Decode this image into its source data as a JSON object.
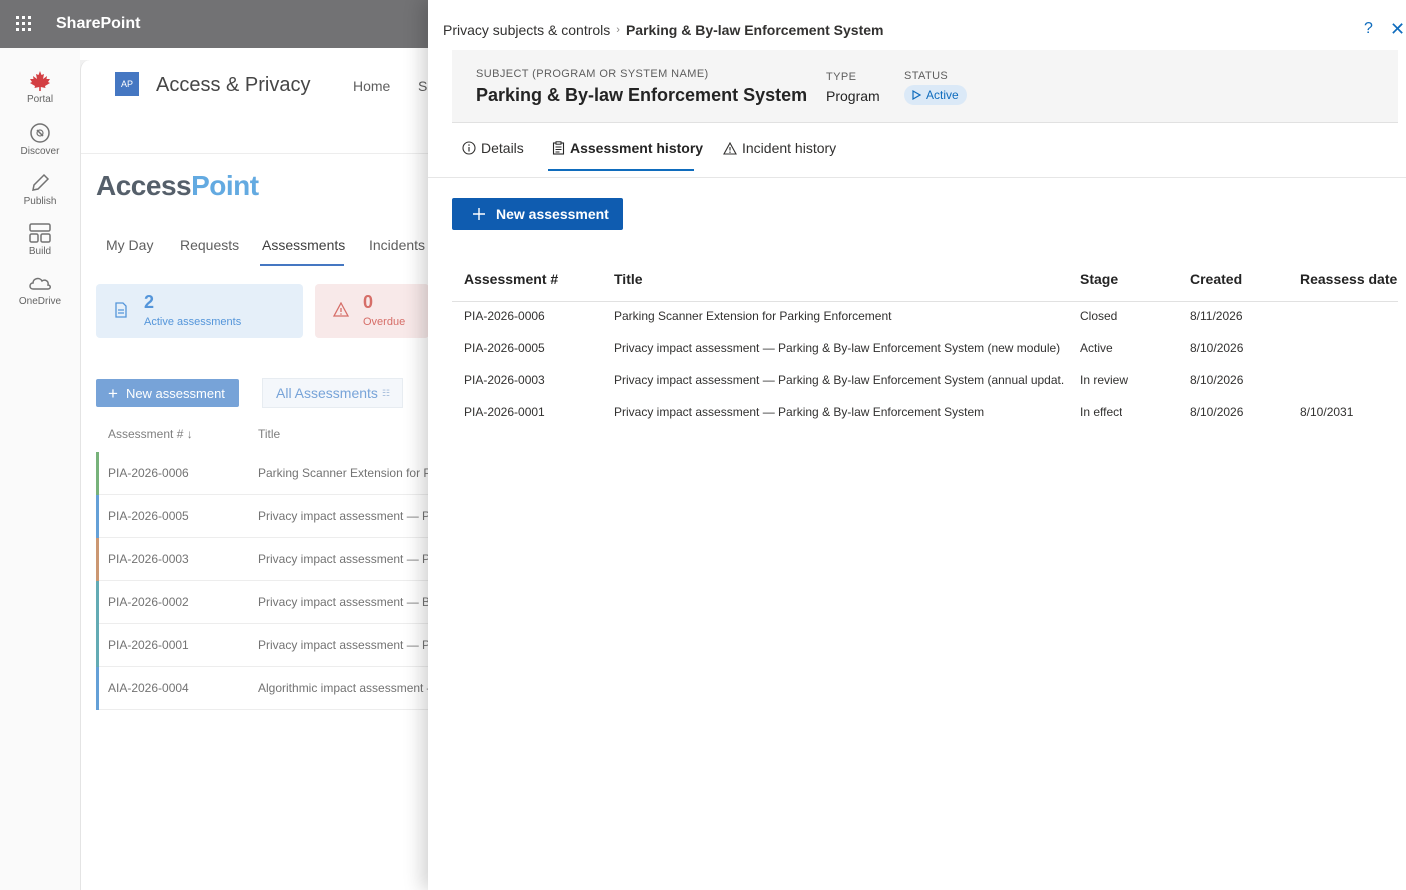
{
  "suite": {
    "app_name": "SharePoint"
  },
  "app_rail": [
    {
      "label": "Portal",
      "icon": "maple-leaf-icon"
    },
    {
      "label": "Discover",
      "icon": "compass-icon"
    },
    {
      "label": "Publish",
      "icon": "pen-icon"
    },
    {
      "label": "Build",
      "icon": "grid-icon"
    },
    {
      "label": "OneDrive",
      "icon": "cloud-icon"
    }
  ],
  "site": {
    "logo_text": "AP",
    "title": "Access & Privacy",
    "nav": [
      "Home",
      "Si"
    ]
  },
  "app": {
    "logo_part1": "Access",
    "logo_part2": "Point",
    "tabs": [
      "My Day",
      "Requests",
      "Assessments",
      "Incidents"
    ],
    "active_tab": "Assessments",
    "cards": [
      {
        "value": "2",
        "label": "Active assessments",
        "color": "#4a8fd8"
      },
      {
        "value": "0",
        "label": "Overdue",
        "color": "#d4655f"
      }
    ],
    "new_button": "New assessment",
    "view_label": "All Assessments",
    "columns": [
      "Assessment #",
      "Title"
    ],
    "rows": [
      {
        "id": "PIA-2026-0006",
        "title": "Parking Scanner Extension for Parking Enforcement",
        "color": "#6fae72"
      },
      {
        "id": "PIA-2026-0005",
        "title": "Privacy impact assessment — Parking & By-law Enforcement System (new module)",
        "color": "#5b9bd5"
      },
      {
        "id": "PIA-2026-0003",
        "title": "Privacy impact assessment — Parking & By-law Enforcement System (annual update)",
        "color": "#c8916a"
      },
      {
        "id": "PIA-2026-0002",
        "title": "Privacy impact assessment — Building permits",
        "color": "#5aa6b0"
      },
      {
        "id": "PIA-2026-0001",
        "title": "Privacy impact assessment — Parking & By-law Enforcement System",
        "color": "#5aa6b0"
      },
      {
        "id": "AIA-2026-0004",
        "title": "Algorithmic impact assessment —",
        "color": "#5b9bd5"
      }
    ]
  },
  "panel": {
    "breadcrumb": [
      "Privacy subjects & controls",
      "Parking & By-law Enforcement System"
    ],
    "header": {
      "subject_label": "SUBJECT (PROGRAM OR SYSTEM NAME)",
      "subject": "Parking & By-law Enforcement System",
      "type_label": "TYPE",
      "type": "Program",
      "status_label": "STATUS",
      "status": "Active"
    },
    "tabs": [
      {
        "label": "Details",
        "icon": "info-icon"
      },
      {
        "label": "Assessment history",
        "icon": "clipboard-icon"
      },
      {
        "label": "Incident history",
        "icon": "warning-icon"
      }
    ],
    "active_tab": "Assessment history",
    "new_button": "New assessment",
    "table": {
      "columns": [
        "Assessment #",
        "Title",
        "Stage",
        "Created",
        "Reassess date"
      ],
      "rows": [
        {
          "id": "PIA-2026-0006",
          "title": "Parking Scanner Extension for Parking Enforcement",
          "stage": "Closed",
          "created": "8/11/2026",
          "reassess": ""
        },
        {
          "id": "PIA-2026-0005",
          "title": "Privacy impact assessment — Parking & By-law Enforcement System (new module)",
          "stage": "Active",
          "created": "8/10/2026",
          "reassess": ""
        },
        {
          "id": "PIA-2026-0003",
          "title": "Privacy impact assessment — Parking & By-law Enforcement System (annual updat...",
          "stage": "In review",
          "created": "8/10/2026",
          "reassess": ""
        },
        {
          "id": "PIA-2026-0001",
          "title": "Privacy impact assessment — Parking & By-law Enforcement System",
          "stage": "In effect",
          "created": "8/10/2026",
          "reassess": "8/10/2031"
        }
      ]
    }
  }
}
